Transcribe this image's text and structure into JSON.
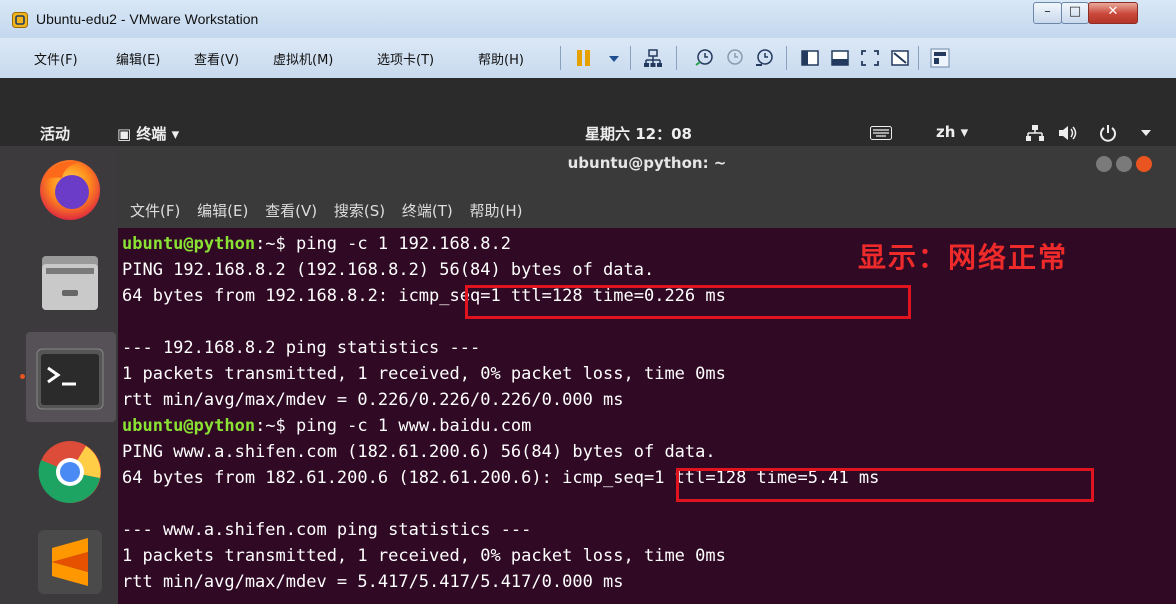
{
  "window": {
    "title": "Ubuntu-edu2 - VMware Workstation",
    "controls": {
      "minimize": "–",
      "maximize": "□",
      "close": "✕"
    }
  },
  "menubar": {
    "items": [
      "文件(F)",
      "编辑(E)",
      "查看(V)",
      "虚拟机(M)",
      "选项卡(T)",
      "帮助(H)"
    ]
  },
  "toolbar_icons": [
    "pause-icon",
    "dropdown-icon",
    "network-icon",
    "snapshot-icon",
    "revert-snapshot-icon",
    "manage-snapshots-icon",
    "sidebar-view-icon",
    "console-view-icon",
    "fullscreen-icon",
    "unity-icon",
    "thumbnail-icon"
  ],
  "gnome_topbar": {
    "activities": "活动",
    "app_menu": "▣ 终端 ▾",
    "clock": "星期六 12：08",
    "input_method": "zh ▾",
    "status_icons": [
      "keyboard-icon",
      "network-icon",
      "volume-icon",
      "power-icon"
    ]
  },
  "dock": {
    "apps": [
      "firefox-icon",
      "files-icon",
      "terminal-icon",
      "chrome-icon",
      "sublime-text-icon"
    ],
    "active": "terminal-icon"
  },
  "terminal": {
    "title": "ubuntu@python: ~",
    "menu": [
      "文件(F)",
      "编辑(E)",
      "查看(V)",
      "搜索(S)",
      "终端(T)",
      "帮助(H)"
    ],
    "annotation": "显示：网络正常",
    "lines": [
      {
        "prompt": "ubuntu@python",
        "rest": ":~$ ping -c 1 192.168.8.2"
      },
      {
        "text": "PING 192.168.8.2 (192.168.8.2) 56(84) bytes of data."
      },
      {
        "text": "64 bytes from 192.168.8.2: icmp_seq=1 ttl=128 time=0.226 ms"
      },
      {
        "text": ""
      },
      {
        "text": "--- 192.168.8.2 ping statistics ---"
      },
      {
        "text": "1 packets transmitted, 1 received, 0% packet loss, time 0ms"
      },
      {
        "text": "rtt min/avg/max/mdev = 0.226/0.226/0.226/0.000 ms"
      },
      {
        "prompt": "ubuntu@python",
        "rest": ":~$ ping -c 1 www.baidu.com"
      },
      {
        "text": "PING www.a.shifen.com (182.61.200.6) 56(84) bytes of data."
      },
      {
        "text": "64 bytes from 182.61.200.6 (182.61.200.6): icmp_seq=1 ttl=128 time=5.41 ms"
      },
      {
        "text": ""
      },
      {
        "text": "--- www.a.shifen.com ping statistics ---"
      },
      {
        "text": "1 packets transmitted, 1 received, 0% packet loss, time 0ms"
      },
      {
        "text": "rtt min/avg/max/mdev = 5.417/5.417/5.417/0.000 ms"
      }
    ]
  }
}
